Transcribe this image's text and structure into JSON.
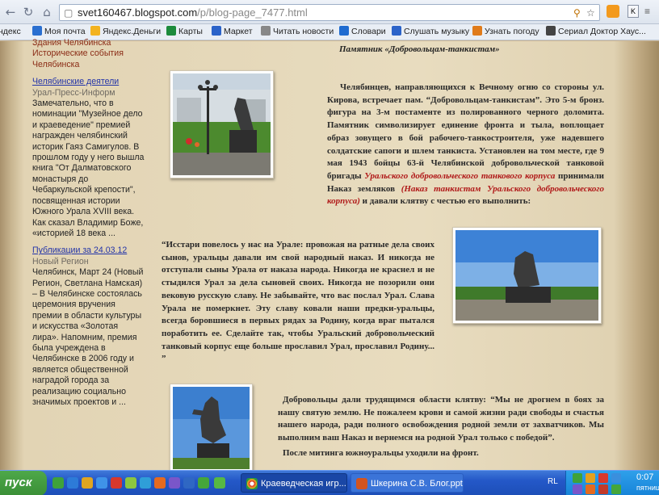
{
  "browser": {
    "url_host": "svet160467.blogspot.com",
    "url_path": "/p/blog-page_7477.html",
    "bookmarks": [
      "ндекс",
      "Моя почта",
      "Яндекс.Деньги",
      "Карты",
      "Маркет",
      "Читать новости",
      "Словари",
      "Слушать музыку",
      "Узнать погоду",
      "Сериал Доктор Хаус..."
    ],
    "bookmark_colors": [
      "#d33",
      "#2a6",
      "#f3b320",
      "#1c8b3c",
      "#2b63c9",
      "#888",
      "#1f6bd0",
      "#2b63c9",
      "#e07b1a",
      "#444"
    ],
    "icons": [
      "back-icon",
      "forward-icon",
      "reload-icon",
      "home-icon",
      "page-icon",
      "search-icon",
      "star-icon",
      "bookmark-icon",
      "menu-icon"
    ]
  },
  "sidebar": {
    "top_link": "Здания Челябинска",
    "top_link2": "Исторические события Челябинска",
    "posts": [
      {
        "title": "Челябинские деятели",
        "source": "Урал-Пресс-Информ",
        "text": "Замечательно, что в номинации \"Музейное дело и краеведение\" премией награжден челябинский историк Гаяз Самигулов. В прошлом году у него вышла книга \"От Далматовского монастыря до Чебаркульской крепости\", посвященная истории Южного Урала XVIII века. Как сказал Владимир Боже, «историей 18 века ..."
      },
      {
        "title": "Публикации за 24.03.12",
        "source": "Новый Регион",
        "text": "Челябинск, Март 24 (Новый Регион, Светлана Намская) – В Челябинске состоялась церемония вручения премии в области культуры и искусства «Золотая лира». Напомним, премия была учреждена в Челябинске в 2006 году и является общественной наградой города за реализацию социально значимых проектов и ..."
      }
    ]
  },
  "article": {
    "heading": "Памятник «Добровольцам-танкистам»",
    "para1_a": "Челябинцев, направляющихся к Вечному огню со стороны ул. ",
    "para1_b": "Кирова",
    "para1_c": ", встречает пам. “Добровольцам-танкистам”. Это 5-м бронз. фигура на 3-м постаменте из полированного черного доломита. Памятник символизирует единение фронта и тыла, воплощает образ зовущего в бой рабочего-танкостроителя, уже надевшего солдатские сапоги и шлем танкиста. Установлен на том месте, где 9 мая 1943 бойцы 63-й Челябинской добровольческой танковой бригады ",
    "para1_red1": "Уральского добровольческого танкового корпуса",
    "para1_d": " принимали Наказ земляков ",
    "para1_red2": "(Наказ танкистам Уральского добровольческого корпуса)",
    "para1_e": " и давали клятву с честью его выполнить:",
    "quote": "“Исстари повелось у нас на Урале: провожая на ратные дела своих сынов, уральцы давали им свой народный наказ. И никогда не отступали сыны Урала от наказа народа. Никогда не краснел и не стыдился Урал за дела сыновей своих. Никогда не позорили они вековую русскую славу. Не забывайте, что вас послал Урал. Слава Урала не померкнет. Эту славу ковали наши предки-уральцы, всегда боровшиеся в первых рядах за Родину, когда враг пытался поработить ее. Сделайте так, чтобы Уральский добровольческий танковый корпус еще больше прославил Урал, прославил Родину... ”",
    "para3": "Добровольцы дали трудящимся области клятву: “Мы не дрогнем в боях за нашу святую землю. Не пожалеем крови и самой жизни ради свободы и счастья нашего народа, ради полного освобождения родной земли от захватчиков. Мы выполним ваш Наказ и вернемся на родной Урал только с победой”.",
    "para4": "После митинга южноуральцы уходили на фронт."
  },
  "taskbar": {
    "start_label": "пуск",
    "tasks": [
      "Краеведческая игр...",
      "Шкерина С.В. Блог.ppt"
    ],
    "lang": "RL",
    "time": "0:07",
    "day": "пятниц"
  }
}
